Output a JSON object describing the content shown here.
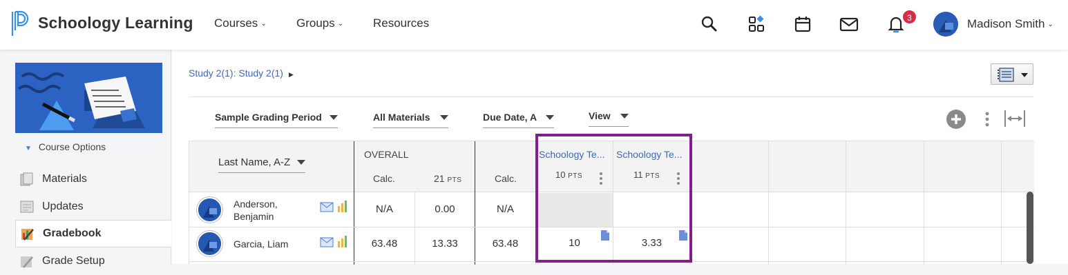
{
  "header": {
    "logo_text": "Schoology Learning",
    "nav": [
      {
        "label": "Courses",
        "has_dropdown": true
      },
      {
        "label": "Groups",
        "has_dropdown": true
      },
      {
        "label": "Resources",
        "has_dropdown": false
      }
    ],
    "notification_count": "3",
    "user_name": "Madison Smith",
    "icons": [
      "search-icon",
      "apps-icon",
      "calendar-icon",
      "mail-icon",
      "notification-bell-icon"
    ]
  },
  "sidebar": {
    "course_options_label": "Course Options",
    "items": [
      {
        "label": "Materials",
        "active": false
      },
      {
        "label": "Updates",
        "active": false
      },
      {
        "label": "Gradebook",
        "active": true
      },
      {
        "label": "Grade Setup",
        "active": false
      }
    ]
  },
  "main": {
    "breadcrumb": "Study 2(1): Study 2(1)",
    "filters": {
      "grading_period": "Sample Grading Period",
      "materials": "All Materials",
      "sort": "Due Date, A",
      "view": "View"
    },
    "grid": {
      "sort_label": "Last Name, A-Z",
      "overall_label": "OVERALL",
      "calc_label": "Calc.",
      "overall_points": "21",
      "pts_unit": "PTS",
      "period_calc_label": "Calc.",
      "assignments": [
        {
          "title": "Schoology Te...",
          "points": "10"
        },
        {
          "title": "Schoology Te...",
          "points": "11"
        }
      ],
      "students": [
        {
          "name_line1": "Anderson,",
          "name_line2": "Benjamin",
          "overall_calc": "N/A",
          "overall_points": "0.00",
          "period_calc": "N/A",
          "grades": [
            "",
            ""
          ]
        },
        {
          "name_line1": "Garcia, Liam",
          "name_line2": "",
          "overall_calc": "63.48",
          "overall_points": "13.33",
          "period_calc": "63.48",
          "grades": [
            "10",
            "3.33"
          ]
        }
      ]
    }
  },
  "colors": {
    "link_blue": "#3f6ab3",
    "highlight_purple": "#7f1f8c",
    "badge_red": "#d62d49",
    "brand_blue": "#2c63c2"
  }
}
